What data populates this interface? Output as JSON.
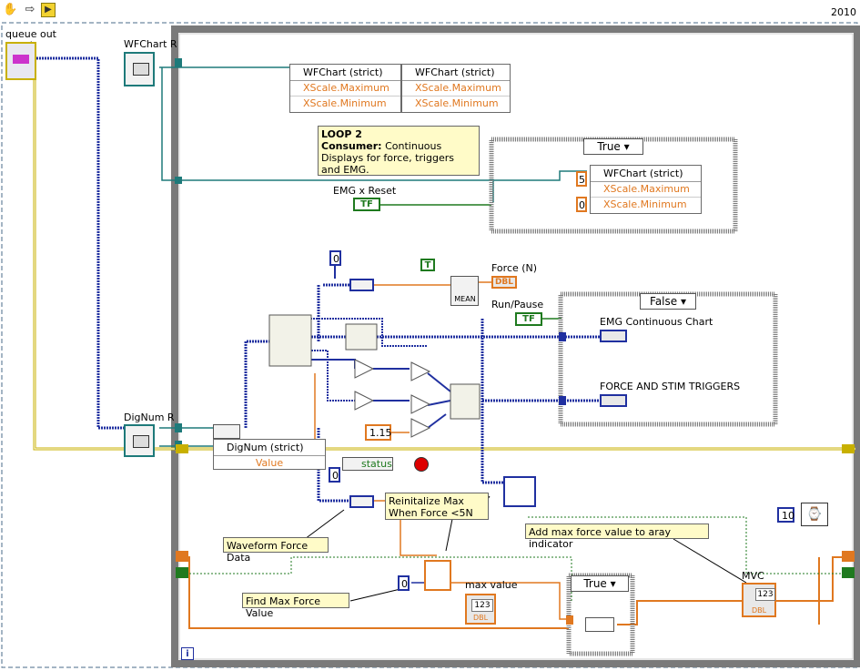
{
  "toolbar": {
    "run_cont_icon": "hand-icon",
    "nav_icon": "arrow-icon",
    "run_icon": "run-arrow-icon",
    "version": "2010"
  },
  "terminals": {
    "queue_out": "queue out",
    "wfchart_ref": "WFChart R",
    "dignum_ref": "DigNum R",
    "queue_out_overlap": "out"
  },
  "wfchart_prop": {
    "header1": "WFChart (strict)",
    "header2": "WFChart (strict)",
    "row1a": "XScale.Maximum",
    "row1b": "XScale.Maximum",
    "row2a": "XScale.Minimum",
    "row2b": "XScale.Minimum"
  },
  "comment_loop2": {
    "title": "LOOP 2",
    "label": "Consumer:",
    "text": " Continuous Displays for force, triggers and EMG."
  },
  "case_true_top": {
    "selector": "True",
    "const5": "5",
    "const0": "0",
    "header": "WFChart (strict)",
    "row1": "XScale.Maximum",
    "row2": "XScale.Minimum"
  },
  "emg_reset": {
    "label": "EMG x Reset",
    "value": "TF"
  },
  "const_zero_top": "0",
  "const_true_mean": "T",
  "mean_label": "MEAN",
  "force_indicator": {
    "label": "Force (N)",
    "type": "DBL"
  },
  "run_pause": {
    "label": "Run/Pause",
    "value": "TF"
  },
  "case_false": {
    "selector": "False",
    "label1": "EMG Continuous Chart",
    "label2": "FORCE AND STIM TRIGGERS"
  },
  "const_115": "1.15",
  "dignum_prop": {
    "header": "DigNum (strict)",
    "row": "Value"
  },
  "status_label": "status",
  "const_zero_mid": "0",
  "note_reinit": "Reinitalize Max When Force <5N",
  "note_waveform": "Waveform Force Data",
  "note_addmax": "Add max force value to aray indicator",
  "note_findmax": "Find Max Force Value",
  "const_ten": "10",
  "max_value": {
    "label": "max value",
    "value": "123",
    "type": "DBL"
  },
  "const_zero_bottom": "0",
  "case_true_bottom": {
    "selector": "True"
  },
  "mvc": {
    "label": "MVC",
    "value": "123",
    "type": "DBL"
  },
  "iteration": "i",
  "colors": {
    "orange": "#e07820",
    "blue": "#2030a0",
    "green": "#1f7a1f",
    "teal": "#1e7a7a",
    "gray_frame": "#8a8a8a"
  }
}
